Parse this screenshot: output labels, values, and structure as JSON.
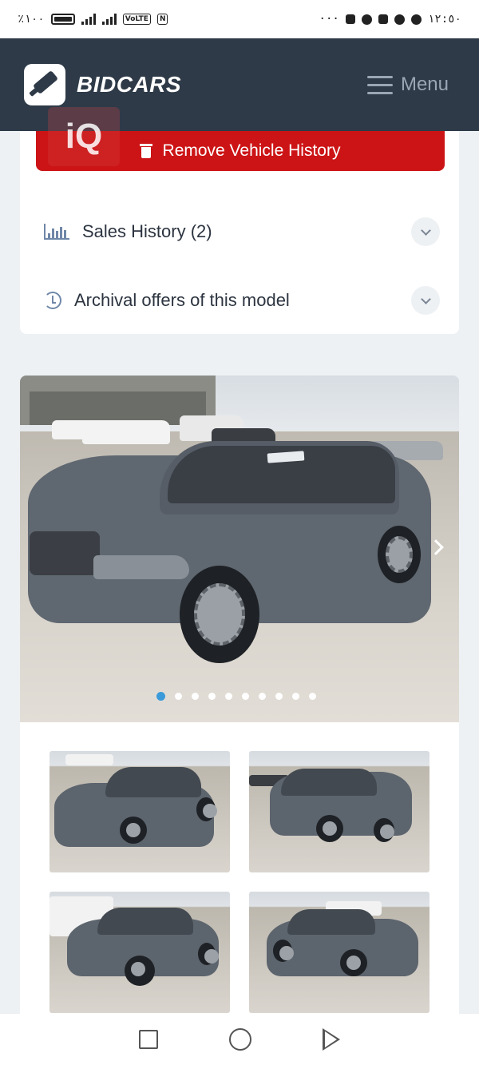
{
  "status_bar": {
    "battery_percent": "٪١٠٠",
    "chip_label": "VoLTE",
    "chip2_label": "N",
    "ellipsis": "···",
    "time": "١٢:٥٠"
  },
  "header": {
    "brand_name": "BIDCARS",
    "menu_label": "Menu",
    "bg_color": "#2e3a48"
  },
  "watermark": {
    "text": "iQ"
  },
  "vehicle_history": {
    "remove_label": "Remove Vehicle History",
    "button_color": "#cc1416"
  },
  "accordion": {
    "items": [
      {
        "label": "Sales History (2)",
        "icon": "bar-chart-icon",
        "expanded": false
      },
      {
        "label": "Archival offers of this model",
        "icon": "history-icon",
        "expanded": false
      }
    ]
  },
  "gallery": {
    "plate_text": "",
    "total_images": 10,
    "active_index": 0,
    "active_dot_color": "#3b9ad9"
  },
  "thumbnails": {
    "count_visible": 4,
    "items": [
      {
        "view": "front-left"
      },
      {
        "view": "rear-left"
      },
      {
        "view": "rear-left-2"
      },
      {
        "view": "right"
      }
    ]
  },
  "navbar": {
    "items": [
      "recent-apps",
      "home",
      "back"
    ]
  }
}
